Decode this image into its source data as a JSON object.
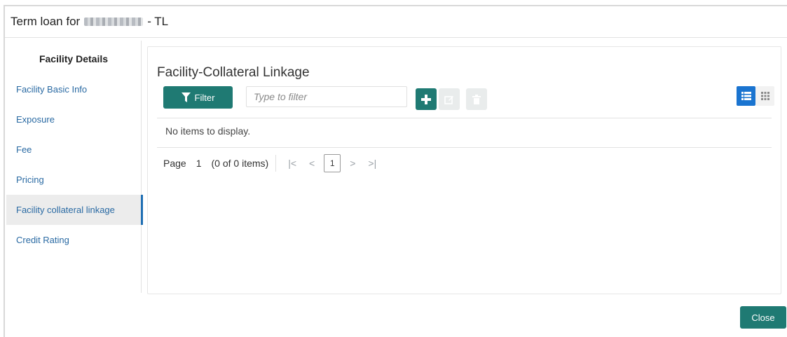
{
  "header": {
    "title_prefix": "Term loan for",
    "title_suffix": "- TL",
    "redacted_name_icon": "blurred-name"
  },
  "sidebar": {
    "title": "Facility Details",
    "items": [
      {
        "label": "Facility Basic Info",
        "active": false
      },
      {
        "label": "Exposure",
        "active": false
      },
      {
        "label": "Fee",
        "active": false
      },
      {
        "label": "Pricing",
        "active": false
      },
      {
        "label": "Facility collateral linkage",
        "active": true
      },
      {
        "label": "Credit Rating",
        "active": false
      }
    ]
  },
  "main": {
    "title": "Facility-Collateral Linkage",
    "toolbar": {
      "filter_label": "Filter",
      "filter_icon": "funnel-icon",
      "filter_placeholder": "Type to filter",
      "add_icon": "plus-icon",
      "edit_icon": "edit-icon",
      "delete_icon": "trash-icon",
      "list_view_icon": "list-view-icon",
      "grid_view_icon": "grid-view-icon"
    },
    "empty_message": "No items to display.",
    "pagination": {
      "page_label": "Page",
      "page_number": "1",
      "items_count": "(0 of 0 items)",
      "current_page": "1"
    }
  },
  "footer": {
    "close_label": "Close"
  },
  "colors": {
    "primary_teal": "#1f7a73",
    "link_blue": "#2a6aa3",
    "active_view_blue": "#1a74d0"
  }
}
